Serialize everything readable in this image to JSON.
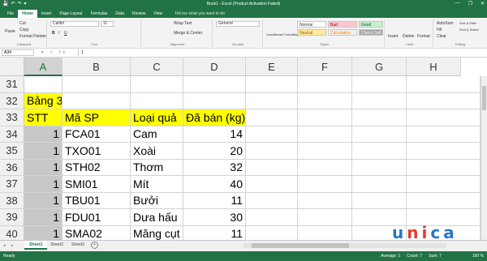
{
  "window": {
    "title": "Book1 - Excel (Product Activation Failed)",
    "quick_access": [
      "💾",
      "↶",
      "↷",
      "▾"
    ],
    "controls": [
      "—",
      "❐",
      "✕"
    ]
  },
  "ribbon": {
    "tabs": [
      "File",
      "Home",
      "Insert",
      "Page Layout",
      "Formulas",
      "Data",
      "Review",
      "View"
    ],
    "active_tab": "Home",
    "tell_me": "Tell me what you want to do",
    "clipboard": {
      "paste": "Paste",
      "cut": "Cut",
      "copy": "Copy",
      "painter": "Format Painter",
      "label": "Clipboard"
    },
    "font": {
      "name": "Calibri",
      "size": "11",
      "label": "Font"
    },
    "alignment": {
      "wrap": "Wrap Text",
      "merge": "Merge & Center",
      "label": "Alignment"
    },
    "number": {
      "format": "General",
      "label": "Number"
    },
    "styles": {
      "conditional": "Conditional Formatting",
      "format_table": "Format as Table",
      "normal": "Normal",
      "bad": "Bad",
      "good": "Good",
      "neutral": "Neutral",
      "calculation": "Calculation",
      "check_cell": "Check Cell",
      "label": "Styles"
    },
    "cells": {
      "insert": "Insert",
      "delete": "Delete",
      "format": "Format",
      "label": "Cells"
    },
    "editing": {
      "autosum": "AutoSum",
      "fill": "Fill",
      "clear": "Clear",
      "sort": "Sort & Filter",
      "find": "Find & Select",
      "label": "Editing"
    }
  },
  "formula_bar": {
    "name_box": "A34",
    "icons": "✕ ✓ fx",
    "value": "1"
  },
  "columns": [
    "A",
    "B",
    "C",
    "D",
    "E",
    "F",
    "G",
    "H"
  ],
  "selected_column": "A",
  "rows": [
    {
      "num": "31",
      "cells": [
        "",
        "",
        "",
        ""
      ]
    },
    {
      "num": "32",
      "cells": [
        "Bảng 3",
        "",
        "",
        ""
      ]
    },
    {
      "num": "33",
      "cells": [
        "STT",
        "Mã SP",
        "Loại quả",
        "Đã bán (kg)"
      ]
    },
    {
      "num": "34",
      "cells": [
        "1",
        "FCA01",
        "Cam",
        "14"
      ]
    },
    {
      "num": "35",
      "cells": [
        "1",
        "TXO01",
        "Xoài",
        "20"
      ]
    },
    {
      "num": "36",
      "cells": [
        "1",
        "STH02",
        "Thơm",
        "32"
      ]
    },
    {
      "num": "37",
      "cells": [
        "1",
        "SMI01",
        "Mít",
        "40"
      ]
    },
    {
      "num": "38",
      "cells": [
        "1",
        "TBU01",
        "Bưởi",
        "11"
      ]
    },
    {
      "num": "39",
      "cells": [
        "1",
        "FDU01",
        "Dưa hấu",
        "30"
      ]
    },
    {
      "num": "40",
      "cells": [
        "1",
        "SMA02",
        "Măng cụt",
        "11"
      ]
    }
  ],
  "sheets": {
    "tabs": [
      "Sheet1",
      "Sheet2",
      "Sheet3"
    ],
    "active": "Sheet1",
    "nav": "◂ ▸",
    "add": "+"
  },
  "status": {
    "mode": "Ready",
    "average": "Average: 1",
    "count": "Count: 7",
    "sum": "Sum: 7",
    "zoom": "160 %"
  },
  "watermark": {
    "letters": [
      "u",
      "n",
      "i",
      "c",
      "a"
    ]
  },
  "colors": {
    "excel_green": "#217346",
    "header_yellow": "#ffff00",
    "selected_grey": "#c8c8c8"
  }
}
